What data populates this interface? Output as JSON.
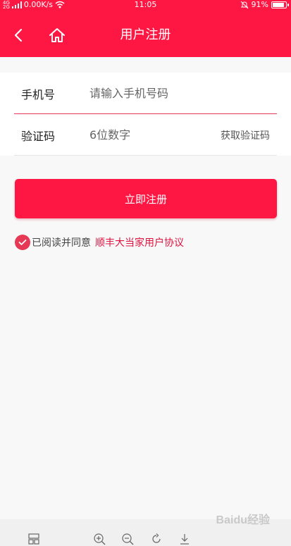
{
  "status_bar": {
    "network": "4G",
    "network2": "2G",
    "speed": "0.00K/s",
    "time": "11:05",
    "battery": "91%",
    "battery_level": 0.91
  },
  "header": {
    "title": "用户注册",
    "back_icon": "back-arrow",
    "home_icon": "home"
  },
  "form": {
    "phone_label": "手机号",
    "phone_placeholder": "请输入手机号码",
    "phone_value": "",
    "code_label": "验证码",
    "code_placeholder": "6位数字",
    "code_value": "",
    "get_code_label": "获取验证码"
  },
  "submit": {
    "label": "立即注册"
  },
  "agreement": {
    "checked": true,
    "text": "已阅读并同意",
    "link": "顺丰大当家用户协议"
  },
  "watermark": "Baidu经验",
  "colors": {
    "accent": "#ff1744",
    "link": "#e0123f",
    "background": "#f8f8f8"
  }
}
